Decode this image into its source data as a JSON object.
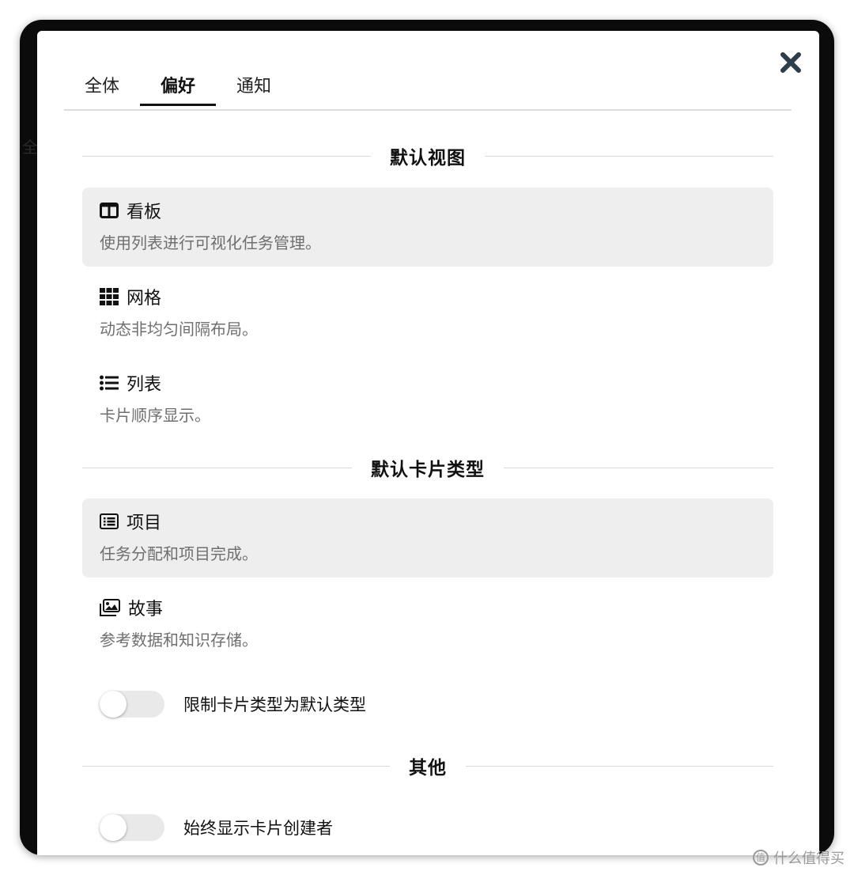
{
  "background_text": "全",
  "tabs": [
    {
      "label": "全体",
      "active": false
    },
    {
      "label": "偏好",
      "active": true
    },
    {
      "label": "通知",
      "active": false
    }
  ],
  "close_icon": "close-icon",
  "sections": {
    "default_view": {
      "heading": "默认视图",
      "options": [
        {
          "icon": "columns-icon",
          "title": "看板",
          "desc": "使用列表进行可视化任务管理。",
          "selected": true
        },
        {
          "icon": "grid-icon",
          "title": "网格",
          "desc": "动态非均匀间隔布局。",
          "selected": false
        },
        {
          "icon": "list-icon",
          "title": "列表",
          "desc": "卡片顺序显示。",
          "selected": false
        }
      ]
    },
    "default_card_type": {
      "heading": "默认卡片类型",
      "options": [
        {
          "icon": "list-alt-icon",
          "title": "项目",
          "desc": "任务分配和项目完成。",
          "selected": true
        },
        {
          "icon": "images-icon",
          "title": "故事",
          "desc": "参考数据和知识存储。",
          "selected": false
        }
      ],
      "toggle": {
        "label": "限制卡片类型为默认类型",
        "on": false
      }
    },
    "other": {
      "heading": "其他",
      "toggle": {
        "label": "始终显示卡片创建者",
        "on": false
      }
    }
  },
  "watermark": {
    "text": "什么值得买",
    "icon_glyph": "值"
  },
  "colors": {
    "selected_bg": "#eeeeee",
    "frame": "#0b0b0b",
    "switch_off": "#e9e9e9"
  }
}
